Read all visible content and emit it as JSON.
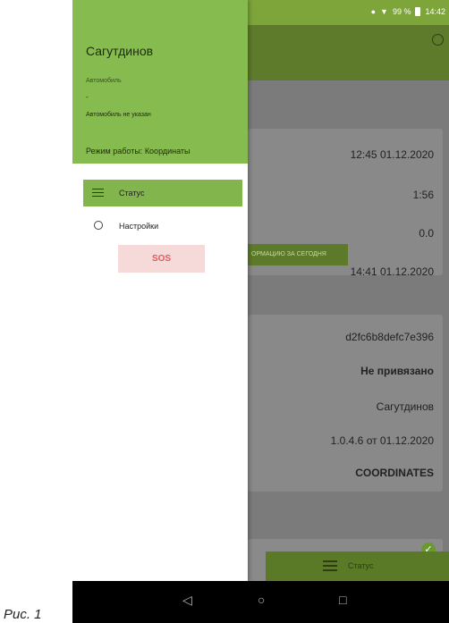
{
  "status_bar": {
    "right_text": "99 % ",
    "time": "14:42"
  },
  "drawer": {
    "user_name": "Сагутдинов",
    "car_label": "Автомобиль",
    "car_value": "-",
    "car_status": "Автомобиль не указан",
    "mode": "Режим работы: Координаты",
    "menu": [
      {
        "label": "Статус",
        "icon": "sliders-icon",
        "active": true
      },
      {
        "label": "Настройки",
        "icon": "gear-icon",
        "active": false
      }
    ],
    "sos_label": "SOS"
  },
  "card1": {
    "rows": [
      "12:45 01.12.2020",
      "1:56",
      "0.0",
      "14:41 01.12.2020"
    ],
    "button_label": "ОРМАЦИЮ ЗА СЕГОДНЯ"
  },
  "card2": {
    "rows": [
      "d2fc6b8defc7e396",
      "Не привязано",
      "Сагутдинов",
      "1.0.4.6 от 01.12.2020",
      "COORDINATES"
    ]
  },
  "bottom_bar": {
    "label": "Статус"
  },
  "nav": {
    "back": "◁",
    "home": "○",
    "recent": "□"
  },
  "caption": "Рис. 1",
  "colors": {
    "accent": "#86bb4f",
    "sos_bg": "#f6d9d9",
    "sos_text": "#e45b5b"
  }
}
